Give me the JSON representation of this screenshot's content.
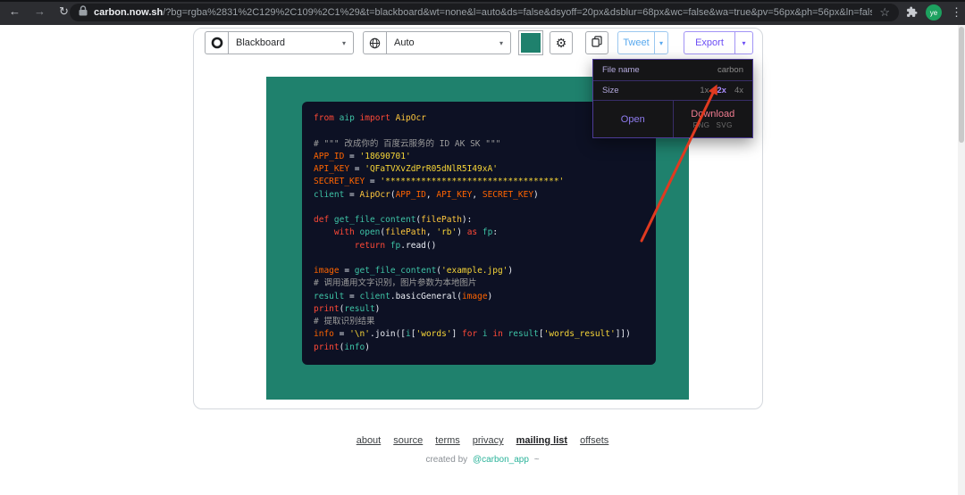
{
  "browser": {
    "url_domain": "carbon.now.sh",
    "url_path": "/?bg=rgba%2831%2C129%2C109%2C1%29&t=blackboard&wt=none&l=auto&ds=false&dsyoff=20px&dsblur=68px&wc=false&wa=true&pv=56px&ph=56px&ln=fals...",
    "avatar_text": "ye"
  },
  "icons": {
    "back": "←",
    "forward": "→",
    "reload": "↻",
    "star": "☆",
    "overflow_menu": "⋮",
    "chevron_down": "▾",
    "gear": "⚙"
  },
  "toolbar": {
    "theme_value": "Blackboard",
    "language_value": "Auto",
    "tweet_label": "Tweet",
    "export_label": "Export"
  },
  "export_menu": {
    "file_name_label": "File name",
    "file_name_value": "carbon",
    "size_label": "Size",
    "size_options": [
      "1x",
      "2x",
      "4x"
    ],
    "size_selected": "2x",
    "open_label": "Open",
    "download_label": "Download",
    "download_formats": [
      "PNG",
      "SVG"
    ]
  },
  "code": {
    "lines": [
      [
        [
          "k",
          "from"
        ],
        [
          "p",
          " "
        ],
        [
          "t",
          "aip"
        ],
        [
          "p",
          " "
        ],
        [
          "k",
          "import"
        ],
        [
          "p",
          " "
        ],
        [
          "y",
          "AipOcr"
        ]
      ],
      [],
      [
        [
          "c",
          "# \"\"\" 改成你的 百度云服务的 ID AK SK \"\"\""
        ]
      ],
      [
        [
          "v",
          "APP_ID"
        ],
        [
          "p",
          " = "
        ],
        [
          "s",
          "'18690701'"
        ]
      ],
      [
        [
          "v",
          "API_KEY"
        ],
        [
          "p",
          " = "
        ],
        [
          "s",
          "'QFaTVXvZdPrR05dNlR5I49xA'"
        ]
      ],
      [
        [
          "v",
          "SECRET_KEY"
        ],
        [
          "p",
          " = "
        ],
        [
          "s",
          "'**********************************'"
        ]
      ],
      [
        [
          "t",
          "client"
        ],
        [
          "p",
          " = "
        ],
        [
          "y",
          "AipOcr"
        ],
        [
          "p",
          "("
        ],
        [
          "v",
          "APP_ID"
        ],
        [
          "p",
          ", "
        ],
        [
          "v",
          "API_KEY"
        ],
        [
          "p",
          ", "
        ],
        [
          "v",
          "SECRET_KEY"
        ],
        [
          "p",
          ")"
        ]
      ],
      [],
      [
        [
          "k",
          "def"
        ],
        [
          "p",
          " "
        ],
        [
          "t",
          "get_file_content"
        ],
        [
          "p",
          "("
        ],
        [
          "y",
          "filePath"
        ],
        [
          "p",
          "):"
        ]
      ],
      [
        [
          "p",
          "    "
        ],
        [
          "k",
          "with"
        ],
        [
          "p",
          " "
        ],
        [
          "t",
          "open"
        ],
        [
          "p",
          "("
        ],
        [
          "y",
          "filePath"
        ],
        [
          "p",
          ", "
        ],
        [
          "s",
          "'rb'"
        ],
        [
          "p",
          ") "
        ],
        [
          "k",
          "as"
        ],
        [
          "p",
          " "
        ],
        [
          "t",
          "fp"
        ],
        [
          "p",
          ":"
        ]
      ],
      [
        [
          "p",
          "        "
        ],
        [
          "k",
          "return"
        ],
        [
          "p",
          " "
        ],
        [
          "t",
          "fp"
        ],
        [
          "p",
          "."
        ],
        [
          "p",
          "read"
        ],
        [
          "p",
          "()"
        ]
      ],
      [],
      [
        [
          "v",
          "image"
        ],
        [
          "p",
          " = "
        ],
        [
          "t",
          "get_file_content"
        ],
        [
          "p",
          "("
        ],
        [
          "s",
          "'example.jpg'"
        ],
        [
          "p",
          ")"
        ]
      ],
      [
        [
          "c",
          "# 调用通用文字识别，图片参数为本地图片"
        ]
      ],
      [
        [
          "t",
          "result"
        ],
        [
          "p",
          " = "
        ],
        [
          "t",
          "client"
        ],
        [
          "p",
          "."
        ],
        [
          "p",
          "basicGeneral"
        ],
        [
          "p",
          "("
        ],
        [
          "v",
          "image"
        ],
        [
          "p",
          ")"
        ]
      ],
      [
        [
          "k",
          "print"
        ],
        [
          "p",
          "("
        ],
        [
          "t",
          "result"
        ],
        [
          "p",
          ")"
        ]
      ],
      [
        [
          "c",
          "# 提取识别结果"
        ]
      ],
      [
        [
          "v",
          "info"
        ],
        [
          "p",
          " = "
        ],
        [
          "s",
          "'\\n'"
        ],
        [
          "p",
          "."
        ],
        [
          "p",
          "join"
        ],
        [
          "p",
          "(["
        ],
        [
          "t",
          "i"
        ],
        [
          "p",
          "["
        ],
        [
          "s",
          "'words'"
        ],
        [
          "p",
          "] "
        ],
        [
          "k",
          "for"
        ],
        [
          "p",
          " "
        ],
        [
          "t",
          "i"
        ],
        [
          "p",
          " "
        ],
        [
          "k",
          "in"
        ],
        [
          "p",
          " "
        ],
        [
          "t",
          "result"
        ],
        [
          "p",
          "["
        ],
        [
          "s",
          "'words_result'"
        ],
        [
          "p",
          "]])"
        ]
      ],
      [
        [
          "k",
          "print"
        ],
        [
          "p",
          "("
        ],
        [
          "t",
          "info"
        ],
        [
          "p",
          ")"
        ]
      ]
    ]
  },
  "footer": {
    "links": [
      {
        "label": "about"
      },
      {
        "label": "source"
      },
      {
        "label": "terms"
      },
      {
        "label": "privacy"
      },
      {
        "label": "mailing list",
        "strong": true
      },
      {
        "label": "offsets"
      }
    ],
    "created_prefix": "created by",
    "handle": "@carbon_app",
    "suffix": "~"
  },
  "colors": {
    "editor_bg": "#1f816d",
    "code_bg": "#0d1124",
    "accent_purple": "#6c4ef5",
    "tweet_blue": "#57a8ee",
    "arrow_red": "#e03a20",
    "open_purple": "#8f7cf0",
    "download_pink": "#ef7b8f",
    "tok_keyword": "#ff4937",
    "tok_variable": "#ff6400",
    "tok_teal": "#3ec3a6",
    "tok_param": "#ffc83d",
    "tok_string": "#f7d638",
    "tok_comment": "#9c9c9c",
    "tok_plain": "#ebeef5"
  }
}
